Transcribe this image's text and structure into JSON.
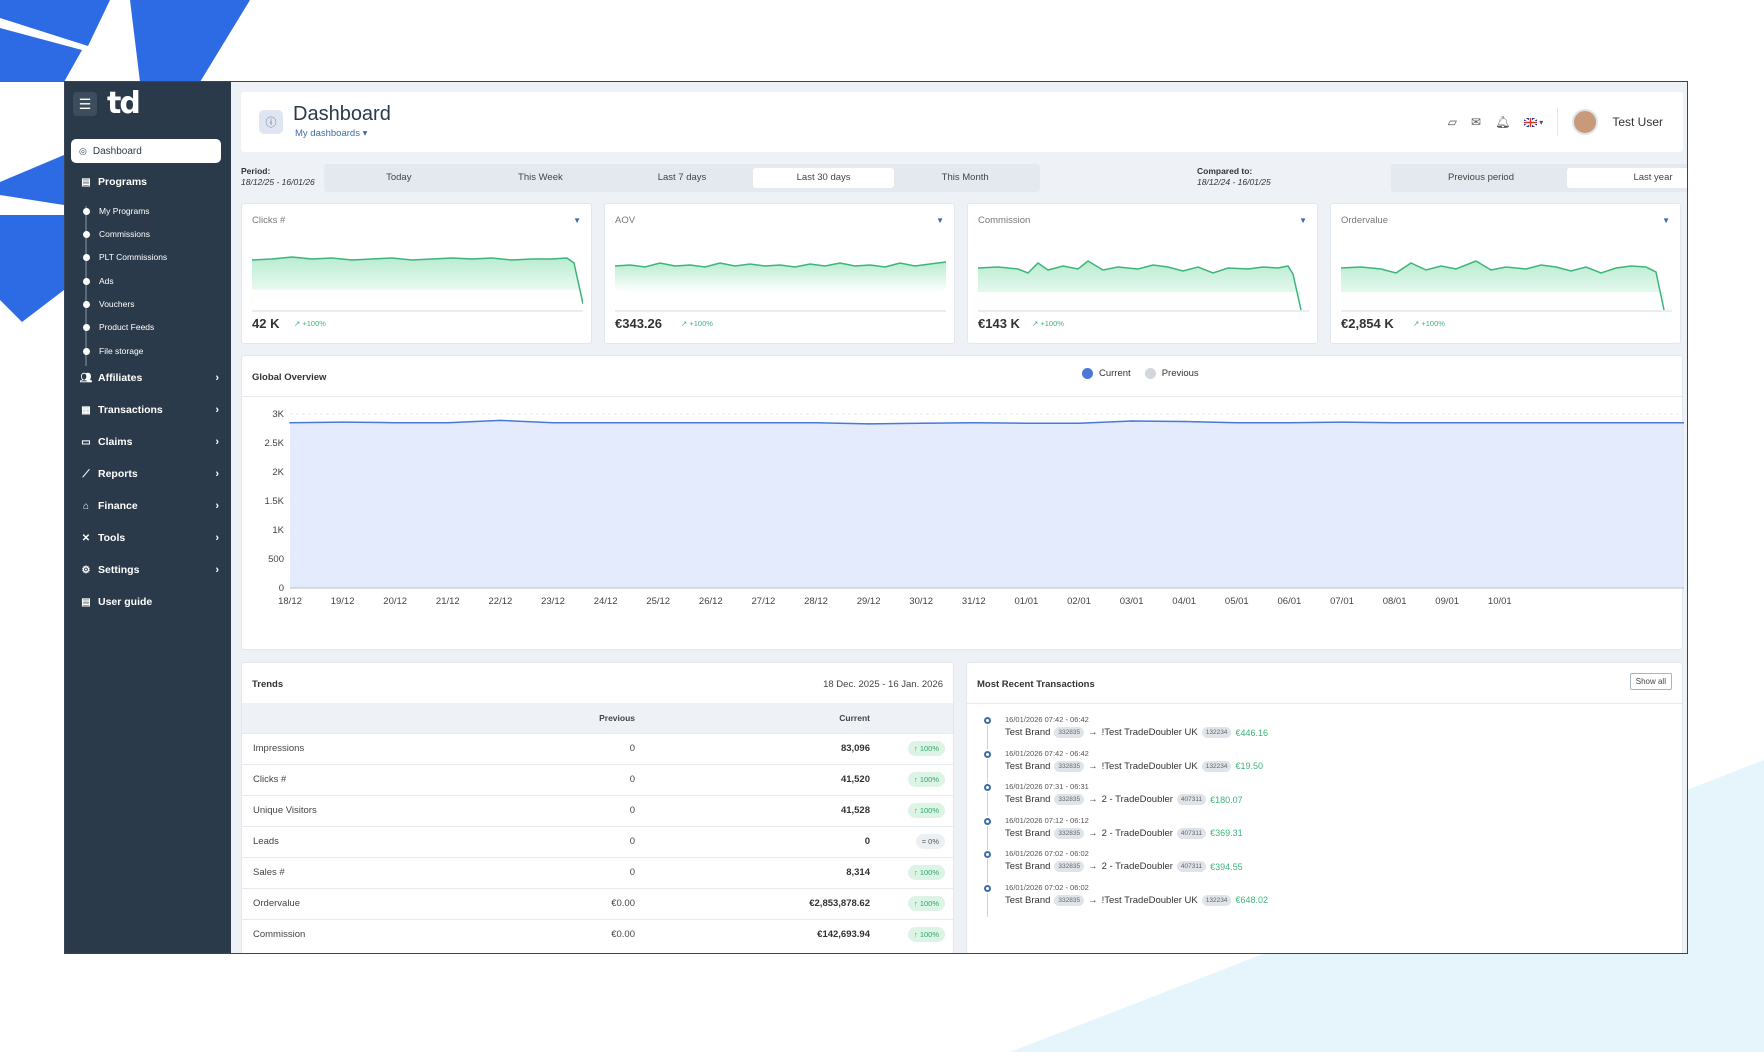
{
  "brand": {
    "logo": "td"
  },
  "sidebar": {
    "active": "Dashboard",
    "programs": {
      "label": "Programs",
      "subitems": [
        "My Programs",
        "Commissions",
        "PLT Commissions",
        "Ads",
        "Vouchers",
        "Product Feeds",
        "File storage"
      ]
    },
    "items": [
      {
        "label": "Affiliates",
        "icon": "users-icon"
      },
      {
        "label": "Transactions",
        "icon": "receipt-icon"
      },
      {
        "label": "Claims",
        "icon": "clipboard-icon"
      },
      {
        "label": "Reports",
        "icon": "chart-line-icon"
      },
      {
        "label": "Finance",
        "icon": "bank-icon"
      },
      {
        "label": "Tools",
        "icon": "tools-icon"
      },
      {
        "label": "Settings",
        "icon": "gear-icon"
      }
    ],
    "user_guide": "User guide"
  },
  "header": {
    "title": "Dashboard",
    "subtitle": "My dashboards",
    "user": "Test User"
  },
  "period": {
    "label": "Period:",
    "range": "18/12/25 - 16/01/26",
    "options": [
      "Today",
      "This Week",
      "Last 7 days",
      "Last 30 days",
      "This Month"
    ],
    "selected": "Last 30 days"
  },
  "compare": {
    "label": "Compared to:",
    "range": "18/12/24 - 16/01/25",
    "options": [
      "Previous period",
      "Last year"
    ],
    "selected": "Last year"
  },
  "kpis": [
    {
      "title": "Clicks #",
      "value": "42 K",
      "delta": "+100%"
    },
    {
      "title": "AOV",
      "value": "€343.26",
      "delta": "+100%"
    },
    {
      "title": "Commission",
      "value": "€143 K",
      "delta": "+100%"
    },
    {
      "title": "Ordervalue",
      "value": "€2,854 K",
      "delta": "+100%"
    }
  ],
  "overview": {
    "title": "Global Overview",
    "legend_current": "Current",
    "legend_previous": "Previous"
  },
  "chart_data": {
    "type": "area",
    "x": [
      "18/12",
      "19/12",
      "20/12",
      "21/12",
      "22/12",
      "23/12",
      "24/12",
      "25/12",
      "26/12",
      "27/12",
      "28/12",
      "29/12",
      "30/12",
      "31/12",
      "01/01",
      "02/01",
      "03/01",
      "04/01",
      "05/01",
      "06/01",
      "07/01",
      "08/01",
      "09/01",
      "10/01"
    ],
    "series": [
      {
        "name": "Current",
        "values": [
          2850,
          2860,
          2850,
          2850,
          2890,
          2850,
          2850,
          2850,
          2850,
          2850,
          2850,
          2830,
          2840,
          2850,
          2840,
          2840,
          2880,
          2870,
          2850,
          2850,
          2860,
          2850,
          2850,
          2850
        ]
      }
    ],
    "yticks": [
      "0",
      "500",
      "1K",
      "1.5K",
      "2K",
      "2.5K",
      "3K"
    ],
    "ylim": [
      0,
      3000
    ],
    "colors": {
      "line": "#4a78d8",
      "fill": "#dfe7fb"
    }
  },
  "trends": {
    "title": "Trends",
    "range": "18 Dec. 2025 - 16 Jan. 2026",
    "col_previous": "Previous",
    "col_current": "Current",
    "rows": [
      {
        "label": "Impressions",
        "previous": "0",
        "current": "83,096",
        "badge": "100%"
      },
      {
        "label": "Clicks #",
        "previous": "0",
        "current": "41,520",
        "badge": "100%"
      },
      {
        "label": "Unique Visitors",
        "previous": "0",
        "current": "41,528",
        "badge": "100%"
      },
      {
        "label": "Leads",
        "previous": "0",
        "current": "0",
        "badge": "0%"
      },
      {
        "label": "Sales #",
        "previous": "0",
        "current": "8,314",
        "badge": "100%"
      },
      {
        "label": "Ordervalue",
        "previous": "€0.00",
        "current": "€2,853,878.62",
        "badge": "100%"
      },
      {
        "label": "Commission",
        "previous": "€0.00",
        "current": "€142,693.94",
        "badge": "100%"
      }
    ]
  },
  "transactions": {
    "title": "Most Recent Transactions",
    "show_all": "Show all",
    "items": [
      {
        "time": "16/01/2026 07:42 - 06:42",
        "from": "Test Brand",
        "from_id": "332835",
        "to": "!Test TradeDoubler UK",
        "to_id": "132234",
        "amount": "€446.16"
      },
      {
        "time": "16/01/2026 07:42 - 06:42",
        "from": "Test Brand",
        "from_id": "332835",
        "to": "!Test TradeDoubler UK",
        "to_id": "132234",
        "amount": "€19.50"
      },
      {
        "time": "16/01/2026 07:31 - 06:31",
        "from": "Test Brand",
        "from_id": "332835",
        "to": "2 - TradeDoubler",
        "to_id": "407311",
        "amount": "€180.07"
      },
      {
        "time": "16/01/2026 07:12 - 06:12",
        "from": "Test Brand",
        "from_id": "332835",
        "to": "2 - TradeDoubler",
        "to_id": "407311",
        "amount": "€369.31"
      },
      {
        "time": "16/01/2026 07:02 - 06:02",
        "from": "Test Brand",
        "from_id": "332835",
        "to": "2 - TradeDoubler",
        "to_id": "407311",
        "amount": "€394.55"
      },
      {
        "time": "16/01/2026 07:02 - 06:02",
        "from": "Test Brand",
        "from_id": "332835",
        "to": "!Test TradeDoubler UK",
        "to_id": "132234",
        "amount": "€648.02"
      }
    ]
  }
}
